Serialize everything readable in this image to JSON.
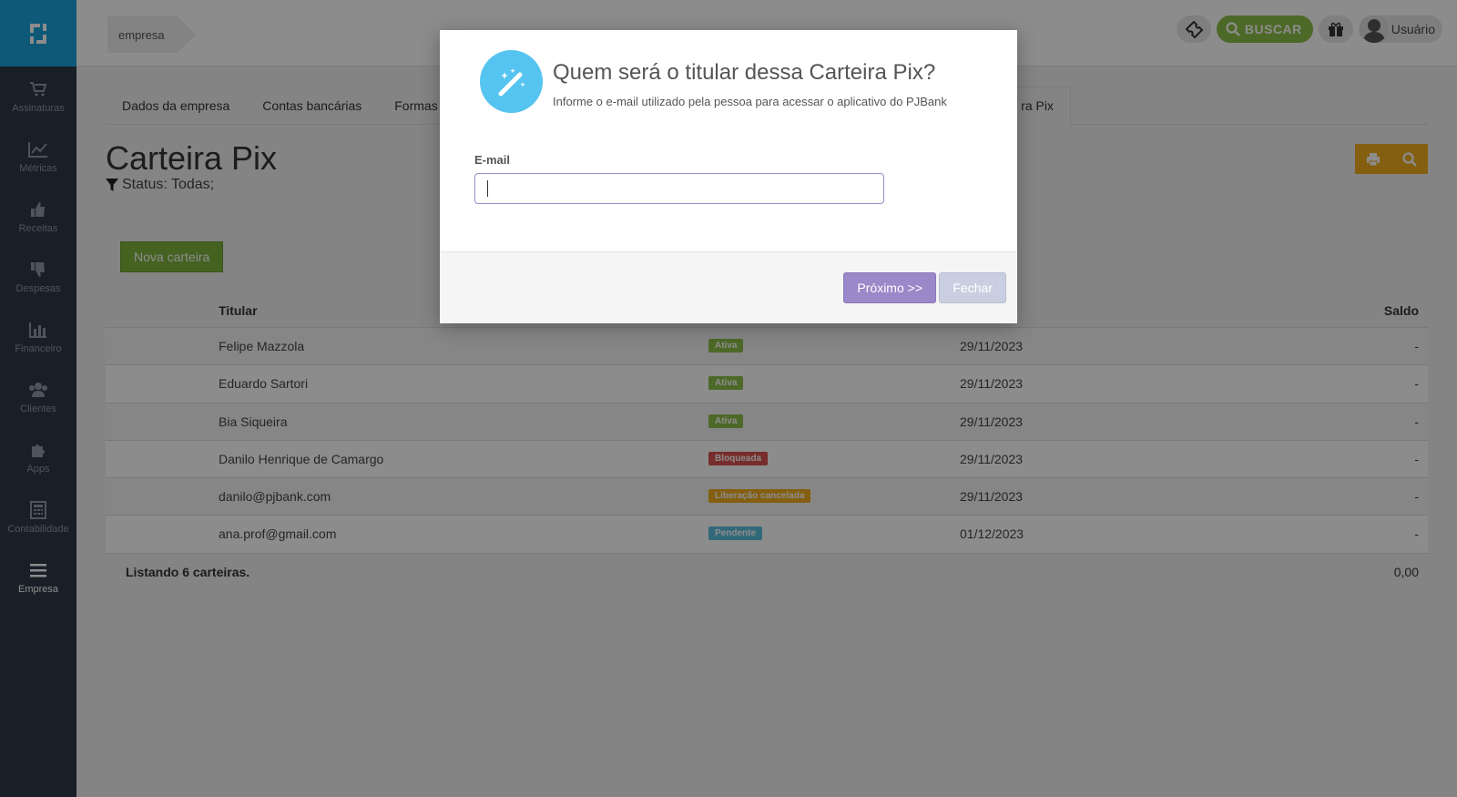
{
  "sidebar": {
    "items": [
      {
        "label": "Assinaturas",
        "icon": "cart-icon"
      },
      {
        "label": "Métricas",
        "icon": "line-chart-icon"
      },
      {
        "label": "Receitas",
        "icon": "thumbs-up-icon"
      },
      {
        "label": "Despesas",
        "icon": "thumbs-down-icon"
      },
      {
        "label": "Financeiro",
        "icon": "bar-chart-icon"
      },
      {
        "label": "Clientes",
        "icon": "users-icon"
      },
      {
        "label": "Apps",
        "icon": "puzzle-icon"
      },
      {
        "label": "Contabilidade",
        "icon": "calculator-icon"
      },
      {
        "label": "Empresa",
        "icon": "menu-icon"
      }
    ]
  },
  "header": {
    "breadcrumb": "empresa",
    "buscar_label": "BUSCAR",
    "user_label": "Usuário"
  },
  "tabs": [
    {
      "label": "Dados da empresa"
    },
    {
      "label": "Contas bancárias"
    },
    {
      "label": "Formas de"
    },
    {
      "label": "ra Pix"
    }
  ],
  "page": {
    "title": "Carteira Pix",
    "filter": "Status: Todas;",
    "new_button": "Nova carteira"
  },
  "table": {
    "headers": {
      "titular": "Titular",
      "saldo": "Saldo"
    },
    "rows": [
      {
        "titular": "Felipe Mazzola",
        "status": "Ativa",
        "date": "29/11/2023",
        "saldo": "-"
      },
      {
        "titular": "Eduardo Sartori",
        "status": "Ativa",
        "date": "29/11/2023",
        "saldo": "-"
      },
      {
        "titular": "Bia Siqueira",
        "status": "Ativa",
        "date": "29/11/2023",
        "saldo": "-"
      },
      {
        "titular": "Danilo Henrique de Camargo",
        "status": "Bloqueada",
        "date": "29/11/2023",
        "saldo": "-"
      },
      {
        "titular": "danilo@pjbank.com",
        "status": "Liberação cancelada",
        "date": "29/11/2023",
        "saldo": "-"
      },
      {
        "titular": "ana.prof@gmail.com",
        "status": "Pendente",
        "date": "01/12/2023",
        "saldo": "-"
      }
    ],
    "footer": {
      "count": "Listando 6 carteiras.",
      "total": "0,00"
    }
  },
  "modal": {
    "title": "Quem será o titular dessa Carteira Pix?",
    "subtitle": "Informe o e-mail utilizado pela pessoa para acessar o aplicativo do PJBank",
    "email_label": "E-mail",
    "email_value": "",
    "next_button": "Próximo >>",
    "close_button": "Fechar"
  },
  "colors": {
    "sidebar": "#2f3a46",
    "logo": "#1ba3db",
    "ativa": "#8dbf4a",
    "bloqueada": "#d9534f",
    "liberacao": "#f0ad1e",
    "pendente": "#5bc0de",
    "next": "#9b88c8"
  }
}
